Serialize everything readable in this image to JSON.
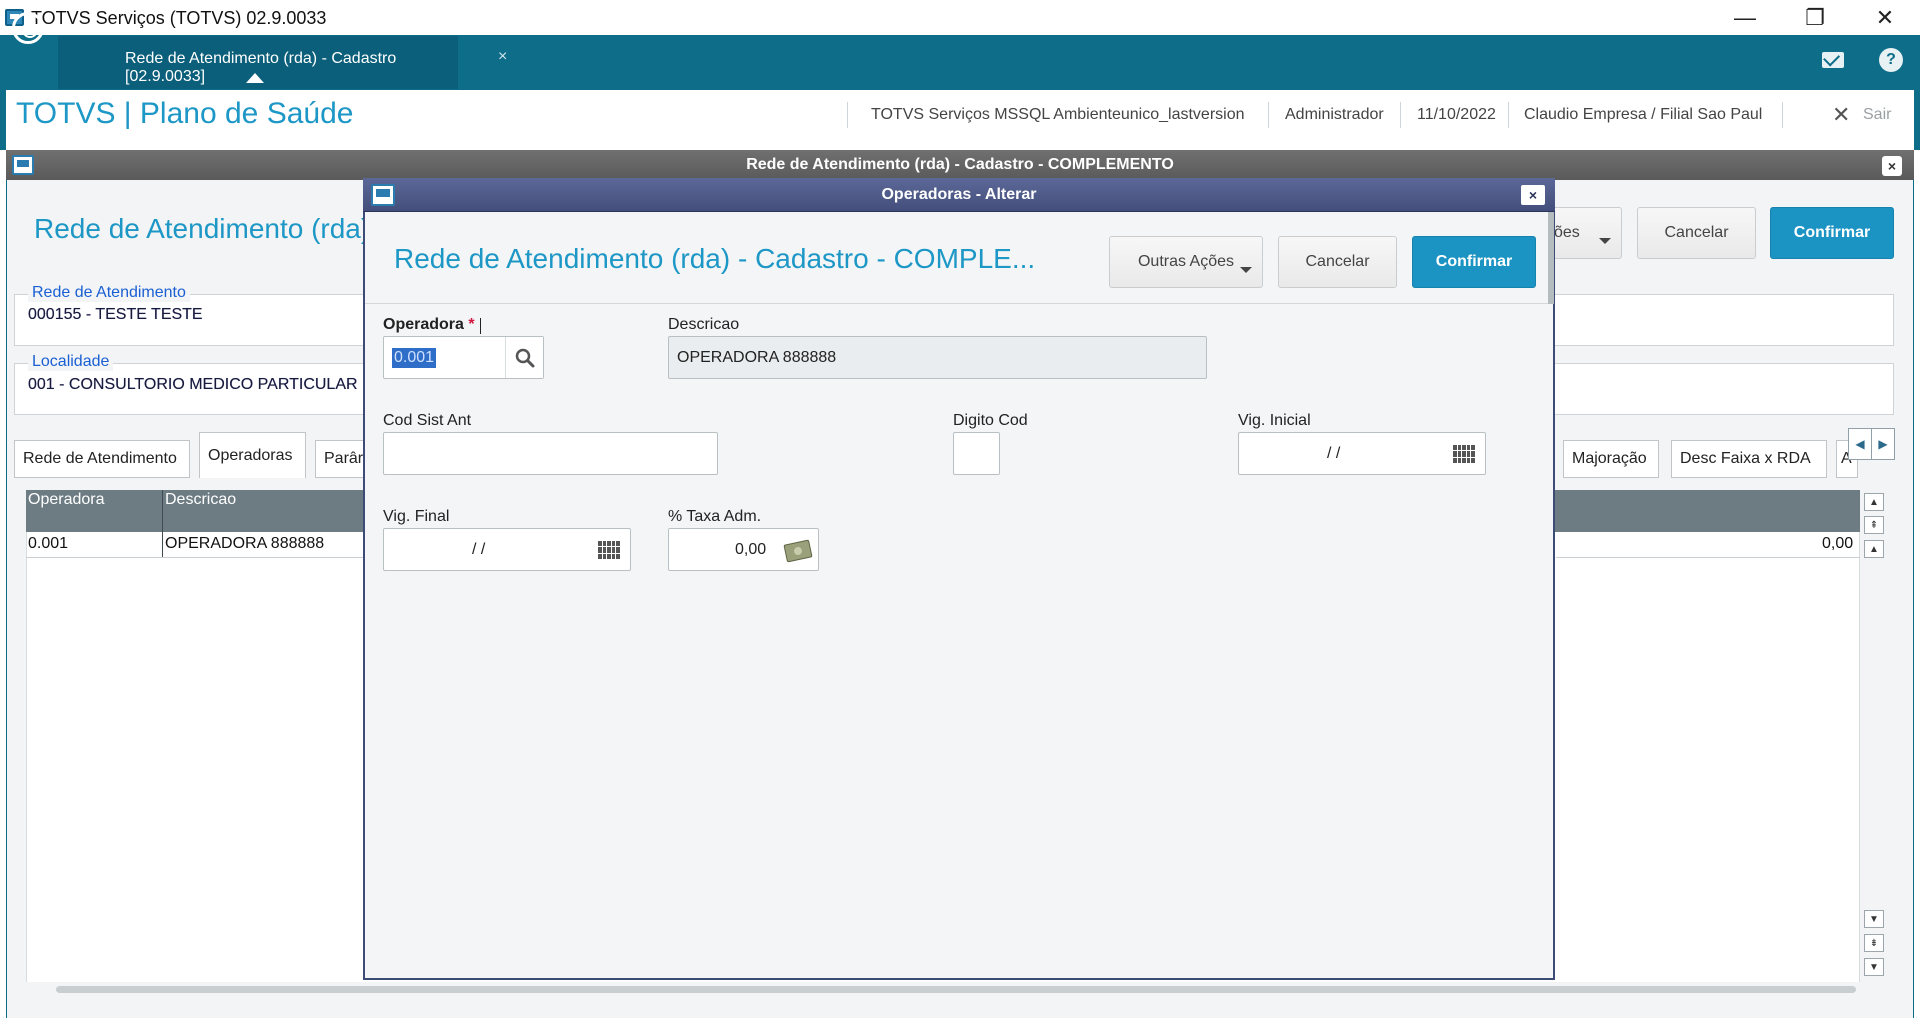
{
  "os_window": {
    "title": "TOTVS Serviços (TOTVS) 02.9.0033",
    "controls": {
      "minimize": "—",
      "restore": "❐",
      "close": "✕"
    }
  },
  "tabbar": {
    "active_tab": "Rede de Atendimento (rda) - Cadastro [02.9.0033]",
    "tab_close": "×",
    "help": "?"
  },
  "header": {
    "app_title": "TOTVS | Plano de Saúde",
    "environment": "TOTVS Serviços MSSQL Ambienteunico_lastversion",
    "user": "Administrador",
    "date": "11/10/2022",
    "company": "Claudio Empresa / Filial Sao Paul",
    "logout_icon": "✕",
    "logout_label": "Sair"
  },
  "background_window": {
    "title": "Rede de Atendimento (rda) - Cadastro - COMPLEMENTO",
    "close": "×",
    "form_title": "Rede de Atendimento (rda)",
    "buttons": {
      "other": "ções",
      "cancel": "Cancelar",
      "confirm": "Confirmar"
    },
    "groups": [
      {
        "legend": "Rede de Atendimento",
        "value": "000155  -  TESTE TESTE"
      },
      {
        "legend": "Localidade",
        "value": "001 - CONSULTORIO MEDICO PARTICULAR"
      }
    ],
    "tabs": [
      "Rede de Atendimento",
      "Operadoras",
      "Parâr",
      "Majoração",
      "Desc Faixa x RDA",
      "A"
    ],
    "grid": {
      "columns": [
        "Operadora",
        "Descricao"
      ],
      "rows": [
        {
          "operadora": "0.001",
          "descricao": "OPERADORA 888888",
          "valor": "0,00"
        }
      ]
    },
    "tab_arrows": {
      "left": "◀",
      "right": "▶"
    }
  },
  "modal": {
    "title": "Operadoras - Alterar",
    "close": "×",
    "form_title": "Rede de Atendimento (rda) - Cadastro - COMPLE...",
    "buttons": {
      "other": "Outras Ações",
      "cancel": "Cancelar",
      "confirm": "Confirmar"
    },
    "fields": {
      "operadora": {
        "label": "Operadora",
        "required": "*",
        "value": "0.001"
      },
      "descricao": {
        "label": "Descricao",
        "value": "OPERADORA 888888"
      },
      "cod_sist_ant": {
        "label": "Cod Sist Ant",
        "value": ""
      },
      "digito_cod": {
        "label": "Digito Cod",
        "value": ""
      },
      "vig_inicial": {
        "label": "Vig. Inicial",
        "value": "/ /"
      },
      "vig_final": {
        "label": "Vig. Final",
        "value": "/ /"
      },
      "taxa_adm": {
        "label": "% Taxa Adm.",
        "value": "0,00"
      }
    }
  },
  "colors": {
    "brand_teal": "#0e6d89",
    "accent_blue": "#1d97c6",
    "confirm_button": "#1b94c3",
    "modal_titlebar": "#4e5a88",
    "legend_blue": "#1a5fd4",
    "required": "#d3163e"
  }
}
